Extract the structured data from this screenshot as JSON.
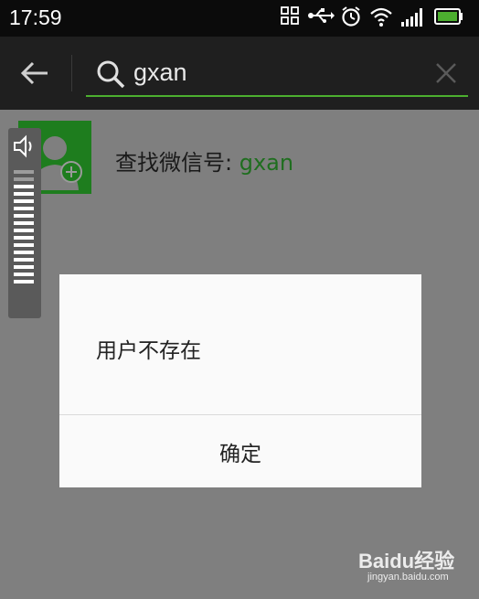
{
  "status_bar": {
    "time": "17:59",
    "icons": [
      "grid-icon",
      "usb-icon",
      "alarm-icon",
      "wifi-icon",
      "signal-icon",
      "battery-icon"
    ],
    "battery_color": "#4caf2f"
  },
  "search": {
    "query": "gxan",
    "accent_color": "#4caf2f"
  },
  "result": {
    "label": "查找微信号: ",
    "keyword": "gxan",
    "avatar_color": "#1e7d1e",
    "icon": "add-contact-icon"
  },
  "volume": {
    "level": 0.875
  },
  "dialog": {
    "message": "用户不存在",
    "confirm_label": "确定"
  },
  "watermark": {
    "brand": "Baidu经验",
    "url": "jingyan.baidu.com"
  }
}
